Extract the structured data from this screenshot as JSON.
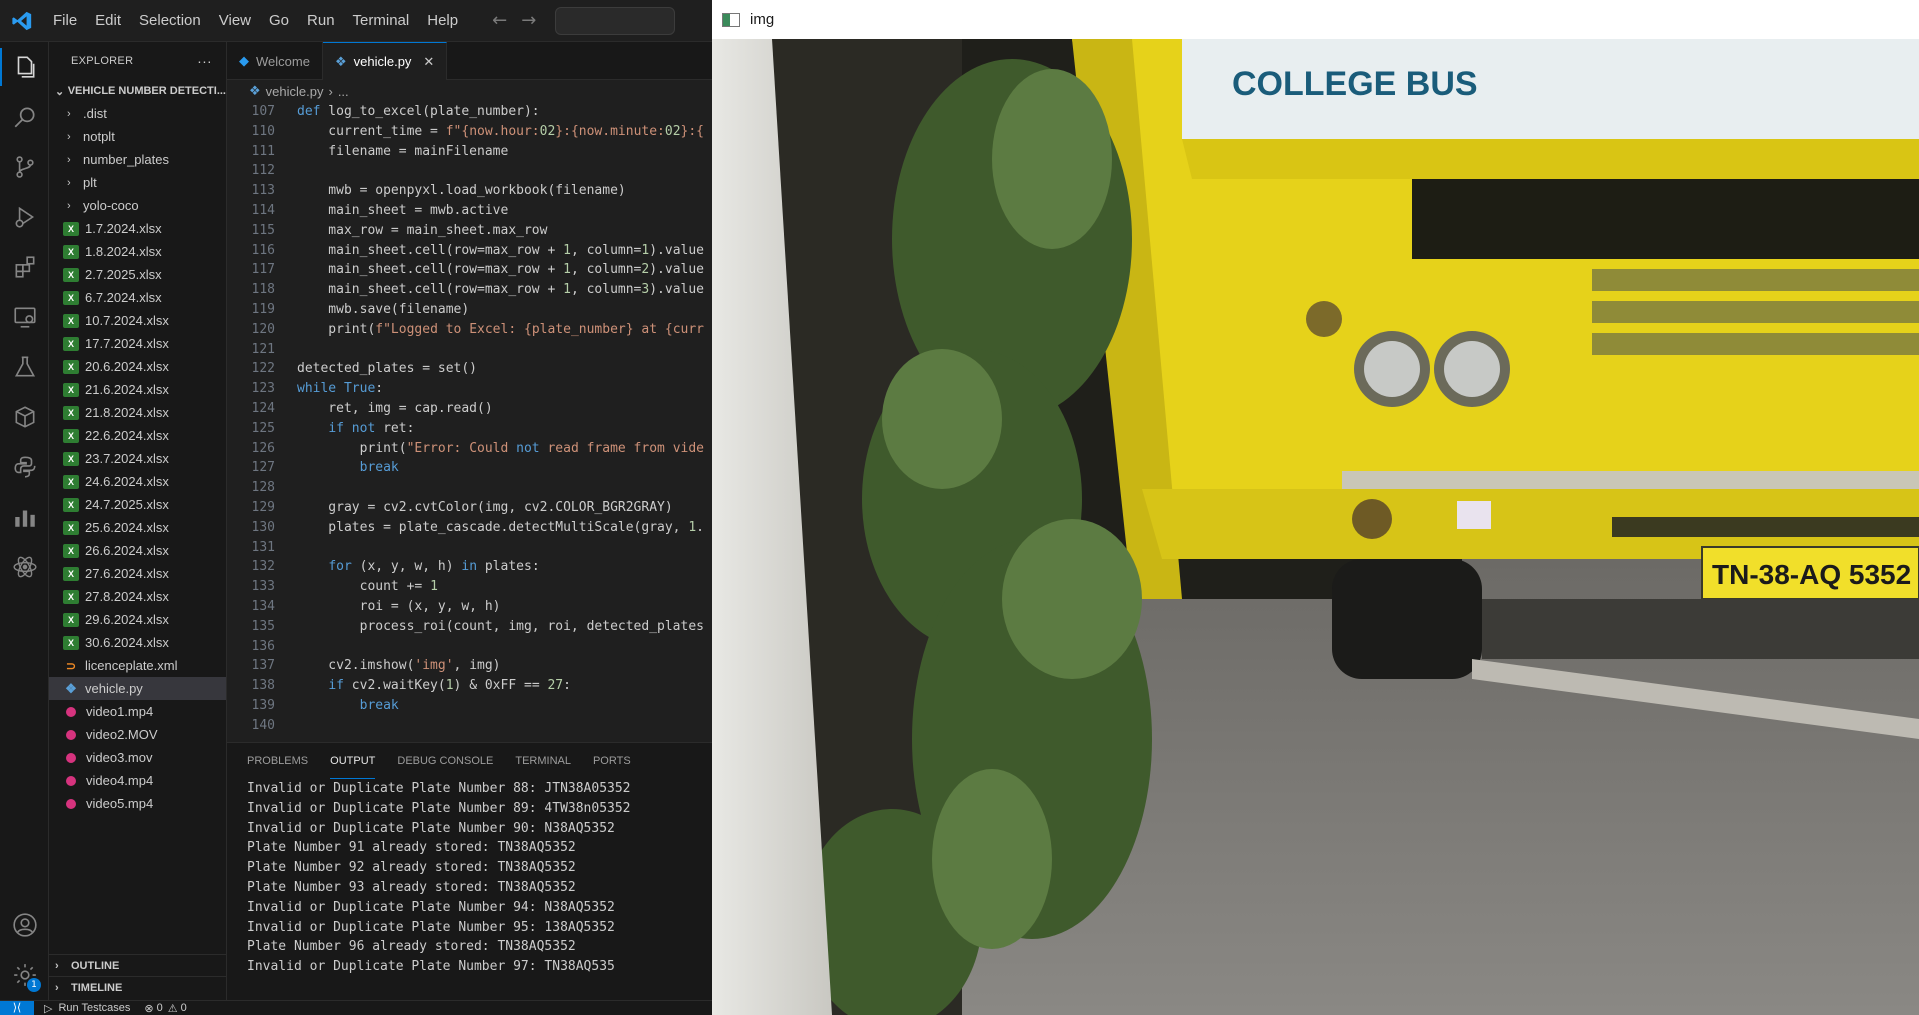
{
  "titlebar": {
    "menu": [
      "File",
      "Edit",
      "Selection",
      "View",
      "Go",
      "Run",
      "Terminal",
      "Help"
    ]
  },
  "sidebar": {
    "title": "EXPLORER",
    "more": "···",
    "folder_name": "VEHICLE NUMBER DETECTI...",
    "folders": [
      ".dist",
      "notplt",
      "number_plates",
      "plt",
      "yolo-coco"
    ],
    "xlsx_files": [
      "1.7.2024.xlsx",
      "1.8.2024.xlsx",
      "2.7.2025.xlsx",
      "6.7.2024.xlsx",
      "10.7.2024.xlsx",
      "17.7.2024.xlsx",
      "20.6.2024.xlsx",
      "21.6.2024.xlsx",
      "21.8.2024.xlsx",
      "22.6.2024.xlsx",
      "23.7.2024.xlsx",
      "24.6.2024.xlsx",
      "24.7.2025.xlsx",
      "25.6.2024.xlsx",
      "26.6.2024.xlsx",
      "27.6.2024.xlsx",
      "27.8.2024.xlsx",
      "29.6.2024.xlsx",
      "30.6.2024.xlsx"
    ],
    "xml_file": "licenceplate.xml",
    "py_file": "vehicle.py",
    "video_files": [
      "video1.mp4",
      "video2.MOV",
      "video3.mov",
      "video4.mp4",
      "video5.mp4"
    ],
    "outline": "OUTLINE",
    "timeline": "TIMELINE",
    "settings_badge": "1"
  },
  "editor": {
    "tabs": [
      {
        "label": "Welcome",
        "icon": "vscode-icon"
      },
      {
        "label": "vehicle.py",
        "icon": "python-icon",
        "close": "✕"
      }
    ],
    "breadcrumb_file": "vehicle.py",
    "breadcrumb_rest": "...",
    "lines": [
      {
        "n": "107",
        "code": "def log_to_excel(plate_number):"
      },
      {
        "n": "110",
        "code": "    current_time = f\"{now.hour:02}:{now.minute:02}:{"
      },
      {
        "n": "111",
        "code": "    filename = mainFilename"
      },
      {
        "n": "112",
        "code": ""
      },
      {
        "n": "113",
        "code": "    mwb = openpyxl.load_workbook(filename)"
      },
      {
        "n": "114",
        "code": "    main_sheet = mwb.active"
      },
      {
        "n": "115",
        "code": "    max_row = main_sheet.max_row"
      },
      {
        "n": "116",
        "code": "    main_sheet.cell(row=max_row + 1, column=1).value"
      },
      {
        "n": "117",
        "code": "    main_sheet.cell(row=max_row + 1, column=2).value"
      },
      {
        "n": "118",
        "code": "    main_sheet.cell(row=max_row + 1, column=3).value"
      },
      {
        "n": "119",
        "code": "    mwb.save(filename)"
      },
      {
        "n": "120",
        "code": "    print(f\"Logged to Excel: {plate_number} at {curr"
      },
      {
        "n": "121",
        "code": ""
      },
      {
        "n": "122",
        "code": "detected_plates = set()"
      },
      {
        "n": "123",
        "code": "while True:"
      },
      {
        "n": "124",
        "code": "    ret, img = cap.read()"
      },
      {
        "n": "125",
        "code": "    if not ret:"
      },
      {
        "n": "126",
        "code": "        print(\"Error: Could not read frame from vide"
      },
      {
        "n": "127",
        "code": "        break"
      },
      {
        "n": "128",
        "code": ""
      },
      {
        "n": "129",
        "code": "    gray = cv2.cvtColor(img, cv2.COLOR_BGR2GRAY)"
      },
      {
        "n": "130",
        "code": "    plates = plate_cascade.detectMultiScale(gray, 1."
      },
      {
        "n": "131",
        "code": ""
      },
      {
        "n": "132",
        "code": "    for (x, y, w, h) in plates:"
      },
      {
        "n": "133",
        "code": "        count += 1"
      },
      {
        "n": "134",
        "code": "        roi = (x, y, w, h)"
      },
      {
        "n": "135",
        "code": "        process_roi(count, img, roi, detected_plates"
      },
      {
        "n": "136",
        "code": ""
      },
      {
        "n": "137",
        "code": "    cv2.imshow('img', img)"
      },
      {
        "n": "138",
        "code": "    if cv2.waitKey(1) & 0xFF == 27:"
      },
      {
        "n": "139",
        "code": "        break"
      },
      {
        "n": "140",
        "code": ""
      }
    ]
  },
  "panel": {
    "tabs": [
      "PROBLEMS",
      "OUTPUT",
      "DEBUG CONSOLE",
      "TERMINAL",
      "PORTS"
    ],
    "active_tab": "OUTPUT",
    "output": [
      "Invalid or Duplicate Plate Number 88: JTN38A05352",
      "Invalid or Duplicate Plate Number 89: 4TW38n05352",
      "Invalid or Duplicate Plate Number 90: N38AQ5352",
      "Plate Number 91 already stored: TN38AQ5352",
      "Plate Number 92 already stored: TN38AQ5352",
      "Plate Number 93 already stored: TN38AQ5352",
      "Invalid or Duplicate Plate Number 94: N38AQ5352",
      "Invalid or Duplicate Plate Number 95: 138AQ5352",
      "Plate Number 96 already stored: TN38AQ5352",
      "Invalid or Duplicate Plate Number 97: TN38AQ535"
    ]
  },
  "statusbar": {
    "run_testcases": "Run Testcases",
    "errors": "0",
    "warnings": "0"
  },
  "image_window": {
    "title": "img",
    "plate_text": "TN-38-AQ 5352",
    "bus_sign": "COLLEGE BUS"
  },
  "colors": {
    "accent": "#0078d4",
    "bus_yellow": "#e6d21a"
  }
}
